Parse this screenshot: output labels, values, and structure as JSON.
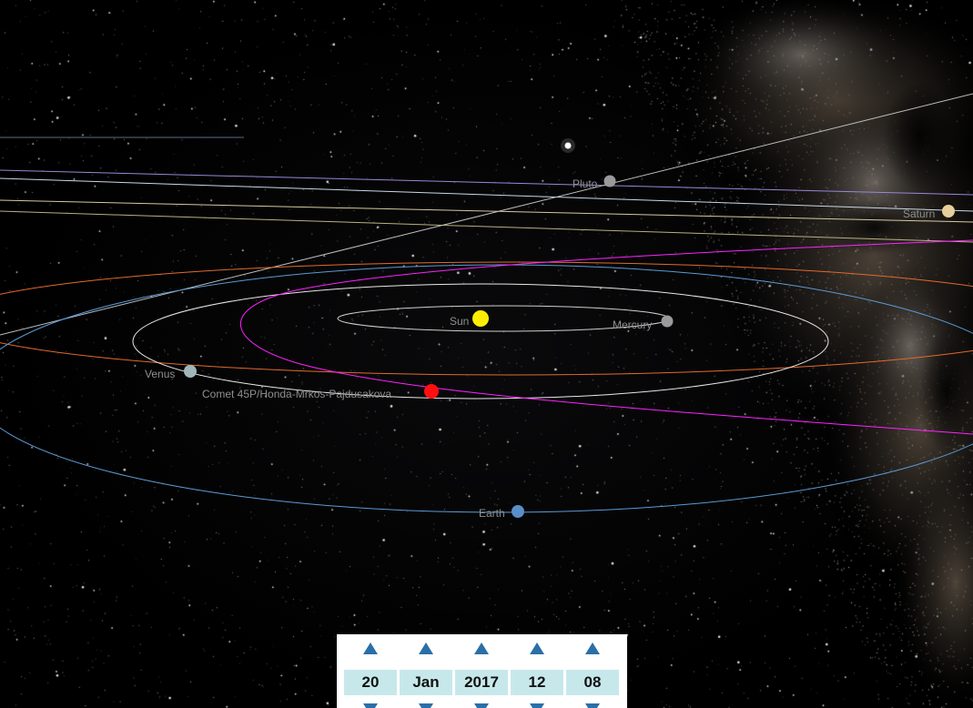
{
  "scene": {
    "bodies": [
      {
        "id": "sun",
        "label": "Sun",
        "color": "#ffee00"
      },
      {
        "id": "mercury",
        "label": "Mercury",
        "color": "#9a9a9a"
      },
      {
        "id": "venus",
        "label": "Venus",
        "color": "#9fb7b8"
      },
      {
        "id": "earth",
        "label": "Earth",
        "color": "#5a8ec9"
      },
      {
        "id": "pluto",
        "label": "Pluto",
        "color": "#9a9a9a"
      },
      {
        "id": "saturn",
        "label": "Saturn",
        "color": "#e6cf9b"
      },
      {
        "id": "comet",
        "label": "Comet 45P/Honda-Mrkos-Pajdusakova",
        "color": "#ff1010"
      }
    ],
    "orbit_colors": {
      "mercury": "#cfcfcf",
      "venus": "#e8e8e8",
      "earth": "#5b9bd5",
      "mars": "#e26a2c",
      "comet": "#ff22ff",
      "jupiter": "#e8e0c0",
      "saturn": "#d4c9a0",
      "uranus": "#c8d8e8",
      "neptune": "#9a87d8",
      "pluto": "#bdbdbd"
    }
  },
  "date_picker": {
    "day": "20",
    "month": "Jan",
    "year": "2017",
    "hour": "12",
    "minute": "08"
  }
}
